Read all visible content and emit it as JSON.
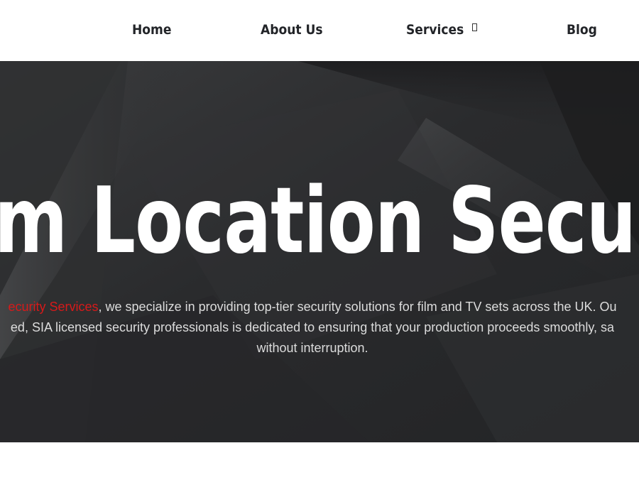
{
  "nav": {
    "items": [
      {
        "label": "Home"
      },
      {
        "label": "About Us"
      },
      {
        "label": "Services",
        "has_dropdown": true,
        "dropdown_icon": "chevron-down-icon"
      },
      {
        "label": "Blog"
      }
    ]
  },
  "hero": {
    "title": "m Location Securi",
    "intro": {
      "line1_highlight": "ecurity Services",
      "line1_rest": ", we specialize in providing top-tier security solutions for film and TV sets across the UK. Ou",
      "line2": "ed, SIA licensed security professionals is dedicated to ensuring that your production proceeds smoothly, sa",
      "line3": "without interruption."
    }
  },
  "colors": {
    "accent": "#d71a1a",
    "nav_text": "#222428",
    "hero_bg": "#2b2c2e",
    "hero_text": "#dcdcdc",
    "hero_title": "#ffffff"
  }
}
